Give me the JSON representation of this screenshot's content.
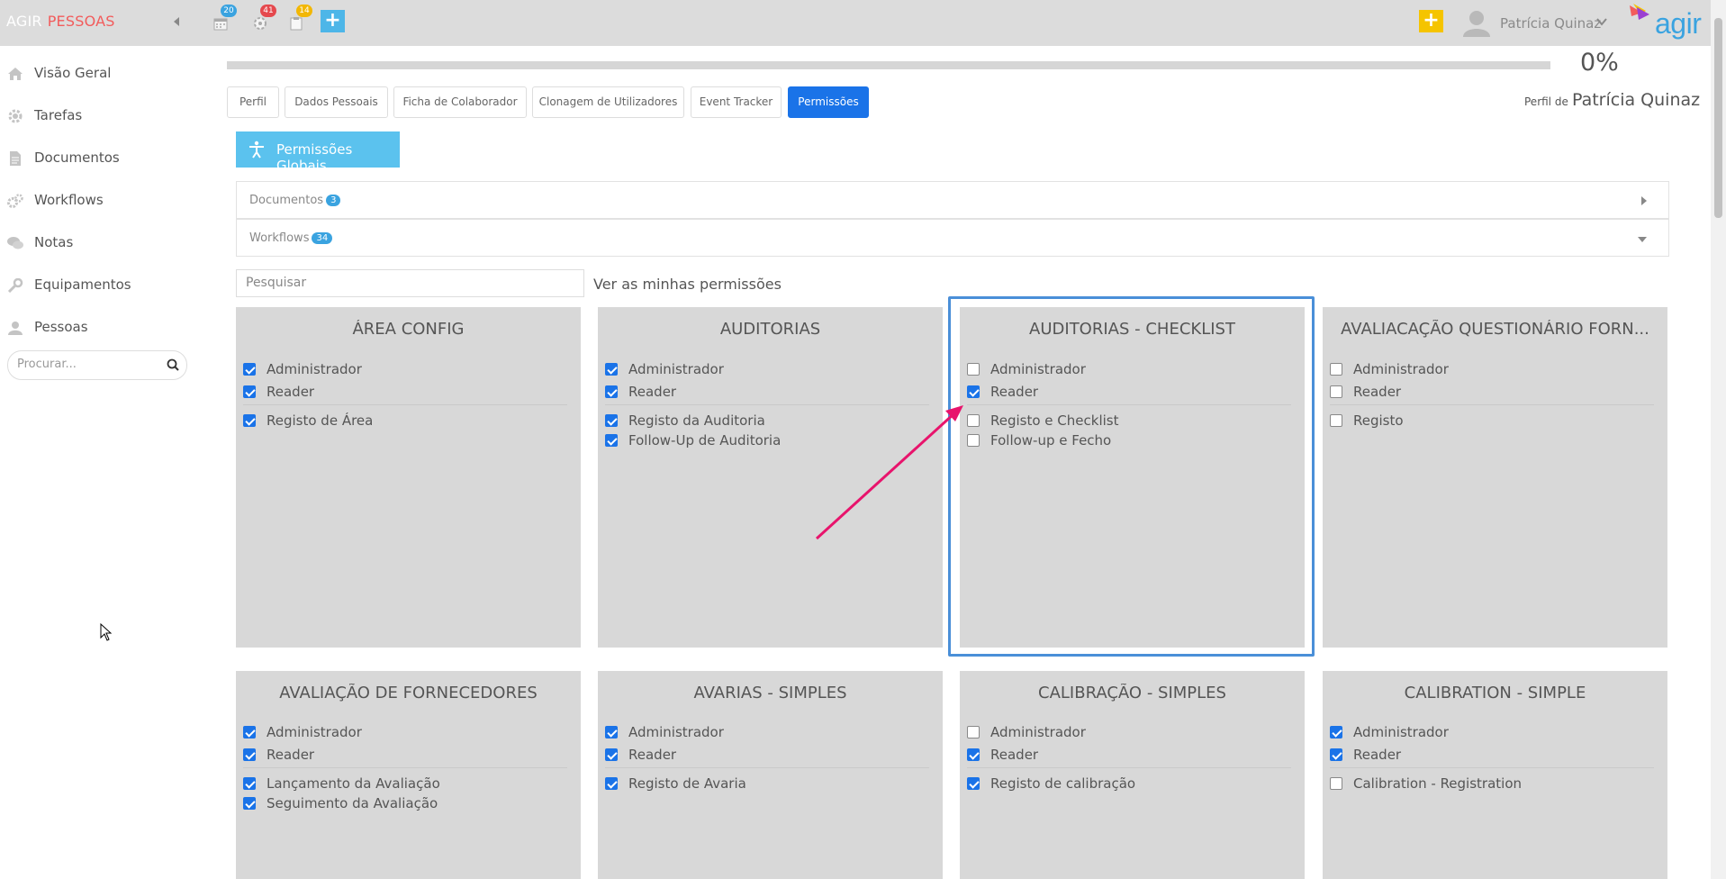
{
  "app": {
    "brand_primary": "AGIR",
    "brand_secondary": "PESSOAS",
    "logo_text": "agir",
    "badges": {
      "calendar": "20",
      "settings": "41",
      "clipboard": "14"
    },
    "user_name": "Patrícia Quinaz"
  },
  "sidebar": {
    "items": [
      {
        "label": "Visão Geral",
        "icon": "home-icon"
      },
      {
        "label": "Tarefas",
        "icon": "gear-icon"
      },
      {
        "label": "Documentos",
        "icon": "document-icon"
      },
      {
        "label": "Workflows",
        "icon": "cogs-icon"
      },
      {
        "label": "Notas",
        "icon": "chat-icon"
      },
      {
        "label": "Equipamentos",
        "icon": "wrench-icon"
      },
      {
        "label": "Pessoas",
        "icon": "user-icon"
      }
    ],
    "search_placeholder": "Procurar..."
  },
  "header": {
    "progress_percent": 0,
    "progress_label": "0%",
    "profile_prefix": "Perfil de",
    "profile_name": "Patrícia Quinaz"
  },
  "tabs": [
    "Perfil",
    "Dados Pessoais",
    "Ficha de Colaborador",
    "Clonagem de Utilizadores",
    "Event Tracker",
    "Permissões"
  ],
  "active_tab": "Permissões",
  "global_button": "Permissões Globais",
  "accordions": [
    {
      "label": "Documentos",
      "count": "3"
    },
    {
      "label": "Workflows",
      "count": "34"
    }
  ],
  "permissions_search_placeholder": "Pesquisar",
  "my_permissions_link": "Ver as minhas permissões",
  "cards": [
    {
      "title": "ÁREA CONFIG",
      "roles": [
        {
          "label": "Administrador",
          "checked": true
        },
        {
          "label": "Reader",
          "checked": true
        }
      ],
      "actions": [
        {
          "label": "Registo de Área",
          "checked": true
        }
      ]
    },
    {
      "title": "AUDITORIAS",
      "roles": [
        {
          "label": "Administrador",
          "checked": true
        },
        {
          "label": "Reader",
          "checked": true
        }
      ],
      "actions": [
        {
          "label": "Registo da Auditoria",
          "checked": true
        },
        {
          "label": "Follow-Up de Auditoria",
          "checked": true
        }
      ]
    },
    {
      "title": "AUDITORIAS - CHECKLIST",
      "roles": [
        {
          "label": "Administrador",
          "checked": false
        },
        {
          "label": "Reader",
          "checked": true
        }
      ],
      "actions": [
        {
          "label": "Registo e Checklist",
          "checked": false
        },
        {
          "label": "Follow-up e Fecho",
          "checked": false
        }
      ]
    },
    {
      "title": "AVALIACAÇÃO QUESTIONÁRIO FORN...",
      "roles": [
        {
          "label": "Administrador",
          "checked": false
        },
        {
          "label": "Reader",
          "checked": false
        }
      ],
      "actions": [
        {
          "label": "Registo",
          "checked": false
        }
      ]
    },
    {
      "title": "AVALIAÇÃO DE FORNECEDORES",
      "roles": [
        {
          "label": "Administrador",
          "checked": true
        },
        {
          "label": "Reader",
          "checked": true
        }
      ],
      "actions": [
        {
          "label": "Lançamento da Avaliação",
          "checked": true
        },
        {
          "label": "Seguimento da Avaliação",
          "checked": true
        }
      ]
    },
    {
      "title": "AVARIAS - SIMPLES",
      "roles": [
        {
          "label": "Administrador",
          "checked": true
        },
        {
          "label": "Reader",
          "checked": true
        }
      ],
      "actions": [
        {
          "label": "Registo de Avaria",
          "checked": true
        }
      ]
    },
    {
      "title": "CALIBRAÇÃO - SIMPLES",
      "roles": [
        {
          "label": "Administrador",
          "checked": false
        },
        {
          "label": "Reader",
          "checked": true
        }
      ],
      "actions": [
        {
          "label": "Registo de calibração",
          "checked": true
        }
      ]
    },
    {
      "title": "CALIBRATION - SIMPLE",
      "roles": [
        {
          "label": "Administrador",
          "checked": true
        },
        {
          "label": "Reader",
          "checked": true
        }
      ],
      "actions": [
        {
          "label": "Calibration - Registration",
          "checked": false
        }
      ]
    }
  ],
  "colors": {
    "accent": "#1a73e8",
    "brand_red": "#f25c5c",
    "info": "#5bc2ee",
    "highlight": "#4a8fd8",
    "annotation_arrow": "#e8146c"
  }
}
